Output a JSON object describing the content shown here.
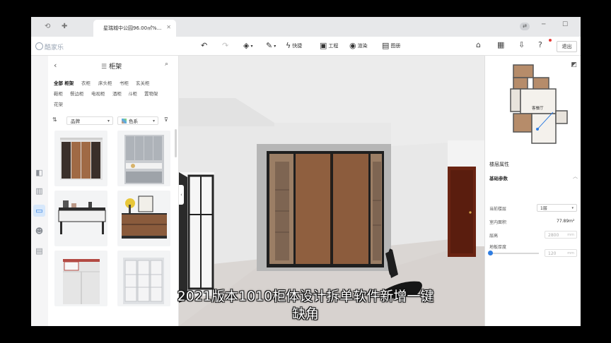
{
  "titlebar": {
    "tab_title": "星瑞城中公园96.00㎡%..."
  },
  "toolbar": {
    "logo": "酷家乐",
    "quick_label": "快捷",
    "project_label": "工程",
    "render_label": "渲染",
    "gallery_label": "图册",
    "exit_label": "退出"
  },
  "catalog": {
    "title": "柜架",
    "filters_row1": [
      "全部 柜架",
      "衣柜",
      "床头柜",
      "书柜",
      "玄关柜"
    ],
    "filters_row2": [
      "鞋柜",
      "餐边柜",
      "电视柜",
      "酒柜",
      "斗柜",
      "置物架"
    ],
    "filters_row3": [
      "花架"
    ],
    "sort_select": "品牌",
    "color_select": "色系"
  },
  "panel": {
    "title": "楼层属性",
    "section": "基础参数",
    "current_floor_label": "当前楼层",
    "current_floor_value": "1层",
    "area_label": "室内面积",
    "area_value": "77.89m²",
    "height_label": "层高",
    "height_value": "2800",
    "height_unit": "mm",
    "floor_thickness_label": "地板厚度",
    "floor_thickness_value": "120",
    "floor_thickness_unit": "mm"
  },
  "minimap": {
    "room_label": "客餐厅"
  },
  "caption": {
    "line1": "2021版本1010柜体设计拆单软件新增一键",
    "line2": "缺角"
  },
  "colors": {
    "accent": "#2f7de1",
    "wood": "#8a5b3c",
    "door": "#6a2412"
  }
}
